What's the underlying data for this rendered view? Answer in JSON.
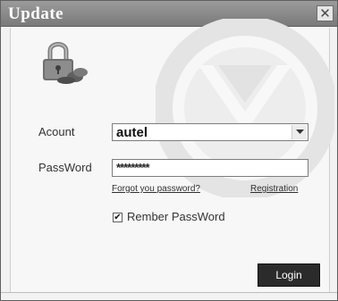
{
  "window": {
    "title": "Update",
    "close_glyph": "✕"
  },
  "form": {
    "account_label": "Acount",
    "account_value": "autel",
    "password_label": "PassWord",
    "password_value": "*********",
    "forgot_link": "Forgot you password?",
    "registration_link": "Registration",
    "remember_checked": true,
    "remember_check_glyph": "✔",
    "remember_label": "Rember PassWord",
    "login_button": "Login"
  },
  "icons": {
    "lock": "lock-icon",
    "dropdown": "chevron-down-icon",
    "watermark": "logo-watermark"
  },
  "colors": {
    "titlebar": "#8a8a8a",
    "window_bg": "#f2f2f2",
    "button_bg": "#2b2b2b"
  }
}
